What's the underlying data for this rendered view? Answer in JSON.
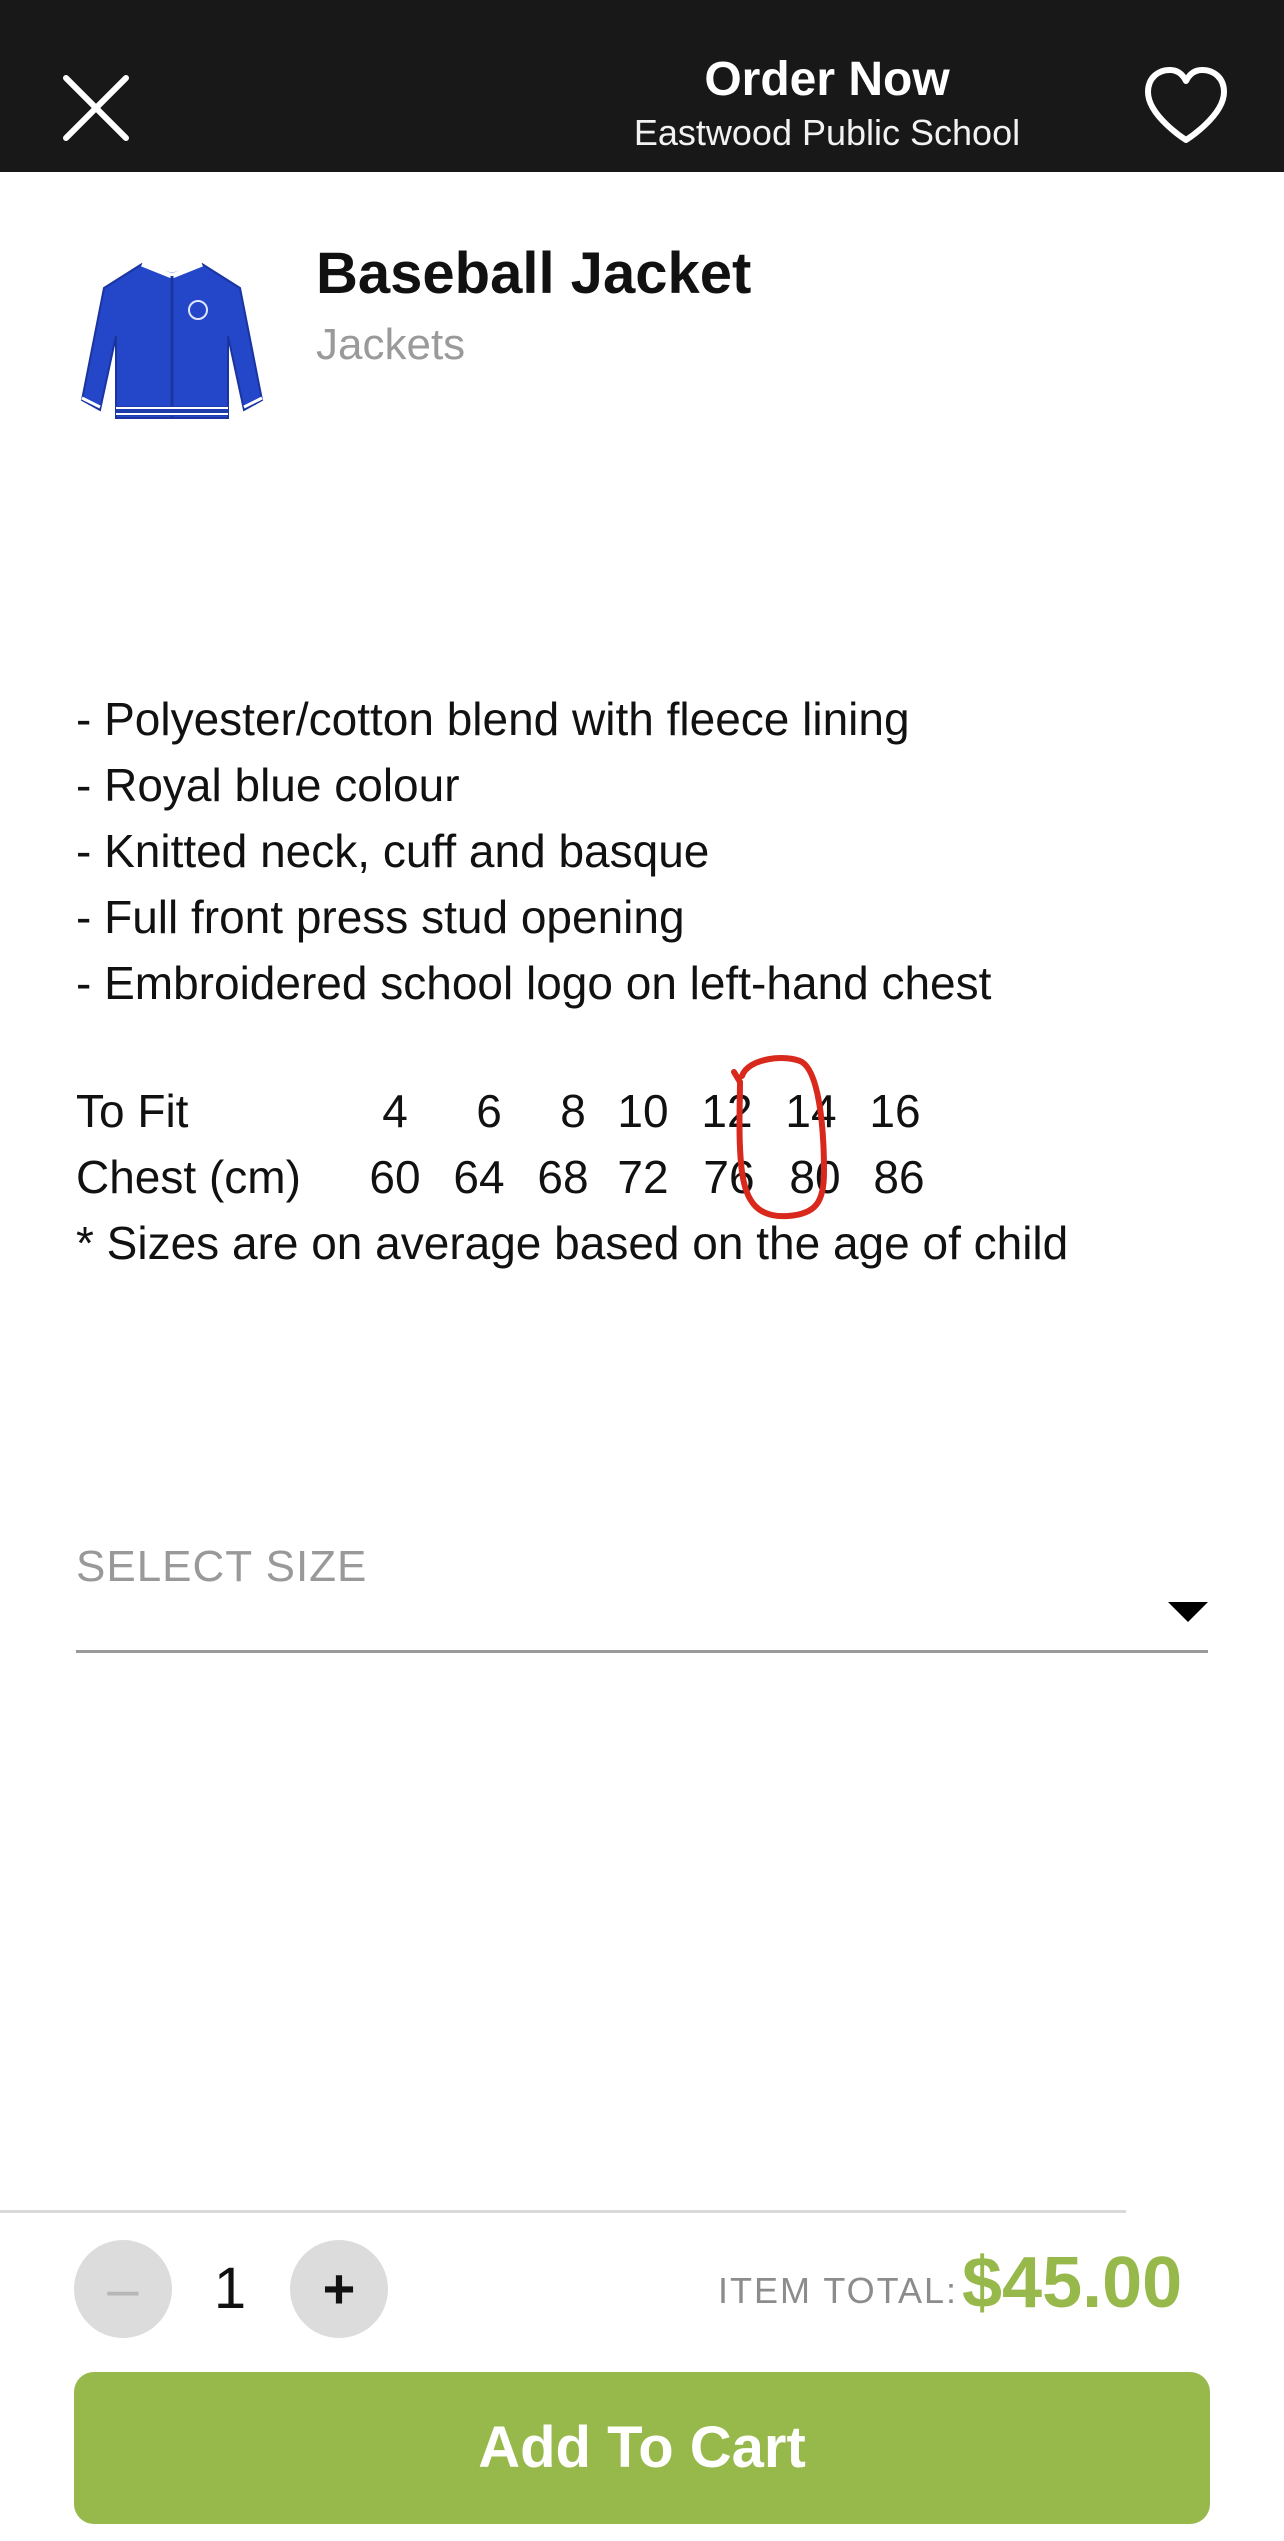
{
  "header": {
    "title": "Order Now",
    "subtitle": "Eastwood Public School",
    "close_icon": "close-icon",
    "favorite_icon": "heart-icon"
  },
  "product": {
    "name": "Baseball Jacket",
    "category": "Jackets",
    "image": "jacket-image",
    "image_color": "#2446c8",
    "description": [
      "- Polyester/cotton blend with fleece lining",
      "- Royal blue colour",
      "- Knitted neck, cuff and basque",
      "- Full front press stud opening",
      "- Embroidered school logo on left-hand chest"
    ],
    "size_chart": {
      "fit_label": "To Fit",
      "chest_label": "Chest (cm)",
      "sizes": [
        "4",
        "6",
        "8",
        "10",
        "12",
        "14",
        "16"
      ],
      "chest": [
        "60",
        "64",
        "68",
        "72",
        "76",
        "80",
        "86"
      ],
      "note": "* Sizes are on average based on the age of child"
    }
  },
  "size_select": {
    "placeholder": "SELECT SIZE"
  },
  "quantity": {
    "minus": "–",
    "value": "1",
    "plus": "+"
  },
  "total": {
    "label": "ITEM TOTAL:",
    "value": "$45.00"
  },
  "add_to_cart": "Add To Cart",
  "colors": {
    "header_bg": "#181818",
    "accent_green": "#97b84a",
    "annotation_red": "#d8291c"
  }
}
